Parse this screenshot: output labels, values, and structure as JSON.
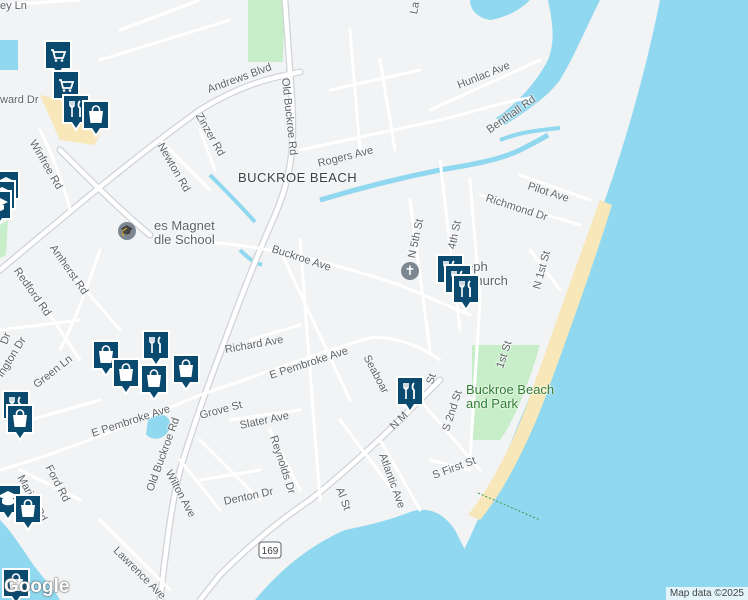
{
  "map": {
    "place_label": "BUCKROE BEACH",
    "streets": {
      "andrews_blvd": "Andrews Blvd",
      "old_buckroe_rd": "Old Buckroe Rd",
      "old_buckroe_rd_lower": "Old Buckroe Rd",
      "zinzer_rd": "Zinzer Rd",
      "newton_rd": "Newton Rd",
      "winfree_rd": "Winfree Rd",
      "amherst_rd": "Amherst Rd",
      "redford_rd": "Redford Rd",
      "buckroe_ave": "Buckroe Ave",
      "rogers_ave": "Rogers Ave",
      "hunlac_ave": "Hunlac Ave",
      "benthall_rd": "Benthall Rd",
      "pilot_ave": "Pilot Ave",
      "richmond_dr": "Richmond Dr",
      "n_5th_st": "N 5th St",
      "n_4th_st": "4th St",
      "n_1st_st": "N 1st St",
      "first_st": "1st St",
      "richard_ave": "Richard Ave",
      "e_pembroke_ave": "E Pembroke Ave",
      "e_pembroke_ave_west": "E Pembroke Ave",
      "seaboard": "Seaboar",
      "grove_st": "Grove St",
      "slater_ave": "Slater Ave",
      "reynolds_dr": "Reynolds Dr",
      "wilton_ave": "Wilton Ave",
      "denton_dr": "Denton Dr",
      "al_st": "Al St",
      "atlantic_ave": "Atlantic Ave",
      "s_2nd_st": "S 2nd St",
      "s_first_st": "S First St",
      "n_mallory": "N M",
      "n_mallory_st": "St",
      "lawrence_ave": "Lawrence Ave",
      "ford_rd": "Ford Rd",
      "marion_rd": "Marion Rd",
      "green_ln": "Green Ln",
      "ington_dr": "ington Dr",
      "ward_dr": "ward Dr",
      "dr_fragment": "Dr",
      "ley_ln": "ey Ln",
      "la_fragment": "La"
    },
    "route_shield": "169",
    "pois": {
      "school": "es Magnet\ndle School",
      "church": "eph\nChurch",
      "park": "Buckroe Beach\nand Park"
    },
    "pins": [
      {
        "icon": "shopping-cart-icon",
        "label": "grocery"
      },
      {
        "icon": "shopping-cart-icon",
        "label": "grocery"
      },
      {
        "icon": "restaurant-icon",
        "label": "restaurant"
      },
      {
        "icon": "shopping-bag-icon",
        "label": "store"
      },
      {
        "icon": "school-icon",
        "label": "school"
      },
      {
        "icon": "school-icon",
        "label": "school"
      },
      {
        "icon": "school-icon",
        "label": "school"
      },
      {
        "icon": "restaurant-icon",
        "label": "restaurant"
      },
      {
        "icon": "restaurant-icon",
        "label": "restaurant"
      },
      {
        "icon": "restaurant-icon",
        "label": "restaurant"
      },
      {
        "icon": "shopping-bag-icon",
        "label": "store"
      },
      {
        "icon": "restaurant-icon",
        "label": "restaurant"
      },
      {
        "icon": "shopping-bag-icon",
        "label": "store"
      },
      {
        "icon": "shopping-bag-icon",
        "label": "store"
      },
      {
        "icon": "shopping-bag-icon",
        "label": "store"
      },
      {
        "icon": "restaurant-icon",
        "label": "restaurant"
      },
      {
        "icon": "restaurant-icon",
        "label": "restaurant"
      },
      {
        "icon": "shopping-bag-icon",
        "label": "store"
      },
      {
        "icon": "school-icon",
        "label": "school"
      },
      {
        "icon": "shopping-bag-icon",
        "label": "store"
      },
      {
        "icon": "shopping-bag-icon",
        "label": "store"
      }
    ],
    "logo": "Google",
    "attribution": "Map data ©2025",
    "colors": {
      "water": "#8fd8ef",
      "land": "#f1f3f4",
      "park": "#c8eec9",
      "beach": "#f7e7b9",
      "road": "#ffffff",
      "major_road": "#cfd3d8",
      "pin": "#0b4a6f"
    }
  }
}
